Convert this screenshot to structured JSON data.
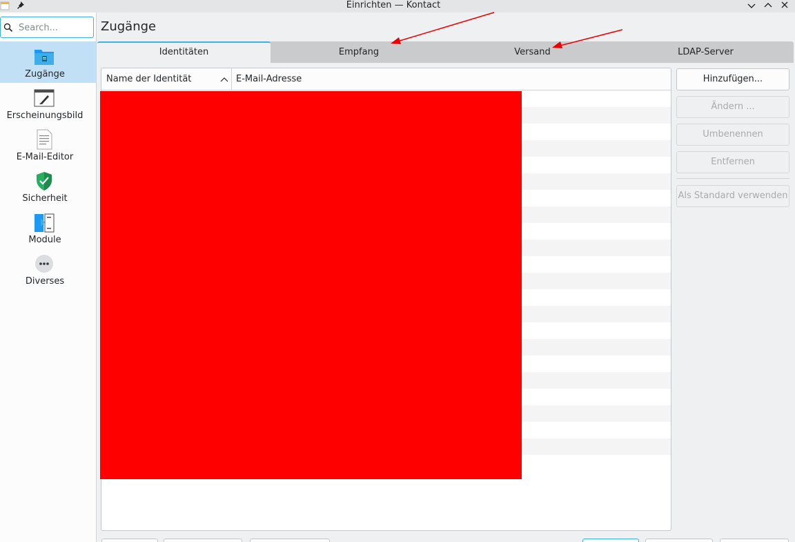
{
  "window": {
    "title": "Einrichten — Kontact"
  },
  "search": {
    "placeholder": "Search..."
  },
  "sidebar": {
    "items": [
      {
        "label": "Zugänge",
        "icon": "accounts-folder-icon"
      },
      {
        "label": "Erscheinungsbild",
        "icon": "appearance-brush-icon"
      },
      {
        "label": "E-Mail-Editor",
        "icon": "email-editor-document-icon"
      },
      {
        "label": "Sicherheit",
        "icon": "security-shield-icon"
      },
      {
        "label": "Module",
        "icon": "modules-icon"
      },
      {
        "label": "Diverses",
        "icon": "more-dots-icon"
      }
    ]
  },
  "page": {
    "title": "Zugänge"
  },
  "tabs": [
    {
      "label": "Identitäten"
    },
    {
      "label": "Empfang"
    },
    {
      "label": "Versand"
    },
    {
      "label": "LDAP-Server"
    }
  ],
  "list": {
    "columns": [
      "Name der Identität",
      "E-Mail-Adresse"
    ]
  },
  "buttons": {
    "add": "Hinzufügen...",
    "modify": "Ändern ...",
    "rename": "Umbenennen",
    "remove": "Entfernen",
    "set_default": "Als Standard verwenden"
  },
  "colors": {
    "accent": "#3daee9",
    "selection": "#c2e0f5",
    "redaction": "#ff0000",
    "annotation_arrow": "#ee0000"
  }
}
